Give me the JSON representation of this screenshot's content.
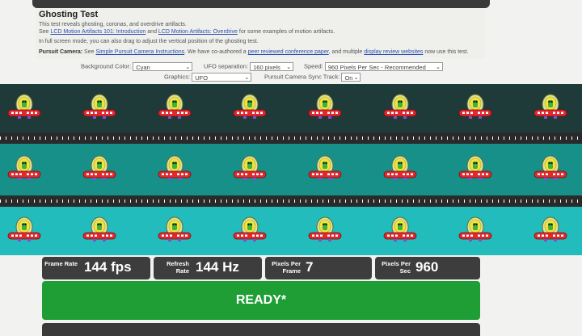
{
  "header": {
    "title": "Ghosting Test",
    "line1": "This test reveals ghosting, coronas, and overdrive artifacts.",
    "line2_prefix": "See",
    "link1": "LCD Motion Artifacts 101: Introduction",
    "line2_mid": "and",
    "link2": "LCD Motion Artifacts: Overdrive",
    "line2_suffix": "for some examples of motion artifacts.",
    "line3": "In full screen mode, you can also drag to adjust the vertical position of the ghosting test.",
    "pursuit_label": "Pursuit Camera:",
    "pursuit_see": "See",
    "link3": "Simple Pursuit Camera Instructions",
    "pursuit_mid": ". We have co-authored a",
    "link4": "peer reviewed conference paper",
    "pursuit_mid2": ", and multiple",
    "link5": "display review websites",
    "pursuit_end": "now use this test."
  },
  "controls": {
    "background_label": "Background Color:",
    "background_value": "Cyan",
    "separation_label": "UFO separation:",
    "separation_value": "160 pixels",
    "speed_label": "Speed:",
    "speed_value": "960 Pixels Per Sec - Recommended",
    "graphics_label": "Graphics:",
    "graphics_value": "UFO",
    "sync_label": "Pursuit Camera Sync Track:",
    "sync_value": "On"
  },
  "tracks": [
    {
      "color": "#1e3b3a"
    },
    {
      "color": "#169088"
    },
    {
      "color": "#22bcbc"
    }
  ],
  "stats": {
    "frame_rate_label": "Frame Rate",
    "frame_rate_value": "144 fps",
    "refresh_label": "Refresh Rate",
    "refresh_value": "144 Hz",
    "ppf_label": "Pixels Per Frame",
    "ppf_value": "7",
    "pps_label": "Pixels Per Sec",
    "pps_value": "960"
  },
  "status": {
    "ready": "READY*"
  },
  "colors": {
    "ready_bg": "#1e9e34",
    "stat_bg": "#3d3d3d",
    "link": "#2a4fb0"
  }
}
